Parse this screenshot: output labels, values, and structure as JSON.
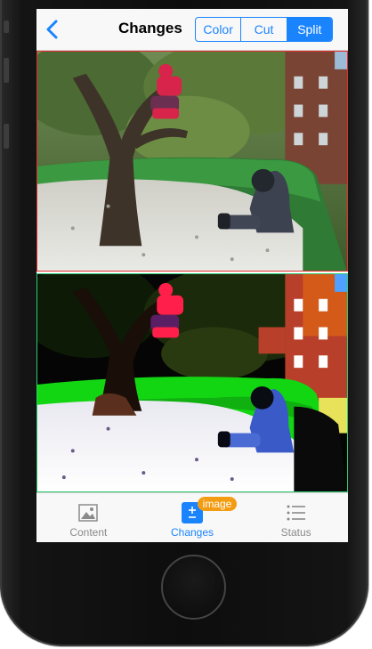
{
  "navbar": {
    "title": "Changes",
    "segments": [
      "Color",
      "Cut",
      "Split"
    ],
    "active_segment": "Split"
  },
  "tabbar": {
    "items": [
      {
        "label": "Content",
        "icon": "image-icon"
      },
      {
        "label": "Changes",
        "icon": "plus-minus-icon",
        "badge": "image"
      },
      {
        "label": "Status",
        "icon": "list-icon"
      }
    ],
    "active": "Changes"
  },
  "colors": {
    "accent": "#1a84ff",
    "badge": "#f39c12",
    "top_border": "#e03030",
    "bottom_border": "#2ecc71"
  }
}
